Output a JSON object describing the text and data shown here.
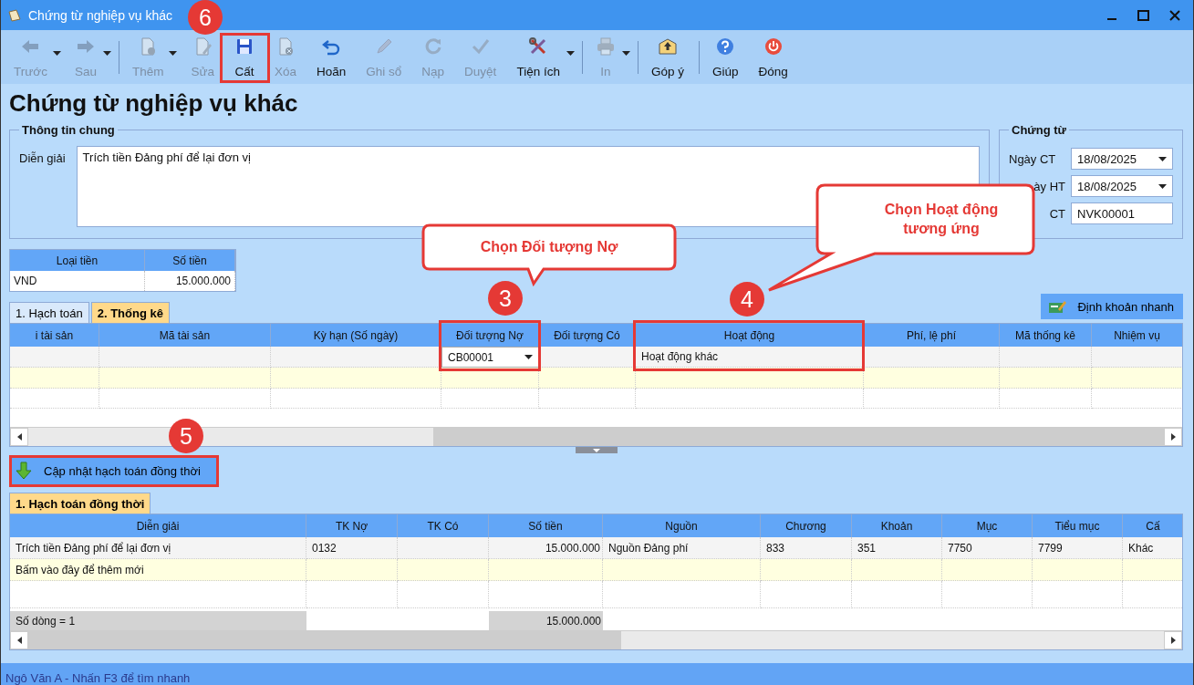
{
  "window": {
    "title": "Chứng từ nghiệp vụ khác"
  },
  "toolbar": [
    {
      "label": "Trước",
      "kind": "back",
      "disabled": true,
      "dropdown": true,
      "group_end": false
    },
    {
      "label": "Sau",
      "kind": "forward",
      "disabled": true,
      "dropdown": true,
      "group_end": true
    },
    {
      "label": "Thêm",
      "kind": "new",
      "disabled": true,
      "dropdown": true,
      "group_end": false
    },
    {
      "label": "Sửa",
      "kind": "edit",
      "disabled": true,
      "dropdown": false,
      "group_end": false
    },
    {
      "label": "Cất",
      "kind": "save",
      "disabled": false,
      "dropdown": false,
      "group_end": false
    },
    {
      "label": "Xóa",
      "kind": "delete",
      "disabled": true,
      "dropdown": false,
      "group_end": false
    },
    {
      "label": "Hoãn",
      "kind": "undo",
      "disabled": false,
      "dropdown": false,
      "group_end": false
    },
    {
      "label": "Ghi sổ",
      "kind": "post",
      "disabled": true,
      "dropdown": false,
      "group_end": false
    },
    {
      "label": "Nạp",
      "kind": "reload",
      "disabled": true,
      "dropdown": false,
      "group_end": false
    },
    {
      "label": "Duyệt",
      "kind": "approve",
      "disabled": true,
      "dropdown": false,
      "group_end": false
    },
    {
      "label": "Tiện ích",
      "kind": "tools",
      "disabled": false,
      "dropdown": true,
      "group_end": true
    },
    {
      "label": "In",
      "kind": "print",
      "disabled": true,
      "dropdown": true,
      "group_end": true
    },
    {
      "label": "Góp ý",
      "kind": "feedback",
      "disabled": false,
      "dropdown": false,
      "group_end": true
    },
    {
      "label": "Giúp",
      "kind": "help",
      "disabled": false,
      "dropdown": false,
      "group_end": false
    },
    {
      "label": "Đóng",
      "kind": "close",
      "disabled": false,
      "dropdown": false,
      "group_end": false
    }
  ],
  "heading": "Chứng từ nghiệp vụ khác",
  "general_info": {
    "legend": "Thông tin chung",
    "description_label": "Diễn giải",
    "description": "Trích tiền Đảng phí để lại đơn vị"
  },
  "voucher": {
    "legend": "Chứng từ",
    "fields": [
      {
        "label": "Ngày CT",
        "value": "18/08/2025",
        "kind": "date"
      },
      {
        "label": "ày HT",
        "value": "18/08/2025",
        "kind": "date"
      },
      {
        "label": "CT",
        "value": "NVK00001",
        "kind": "text"
      }
    ]
  },
  "currency": {
    "columns": [
      "Loại tiền",
      "Số tiền"
    ],
    "rows": [
      [
        "VND",
        "15.000.000"
      ]
    ]
  },
  "quick_entry_button": "Định khoản nhanh",
  "tabs": [
    {
      "label": "1. Hạch toán",
      "selected": false
    },
    {
      "label": "2. Thống kê",
      "selected": true
    }
  ],
  "stats_grid": {
    "columns": [
      {
        "label": "i tài sản",
        "kind": "text"
      },
      {
        "label": "Mã tài sản",
        "kind": "text"
      },
      {
        "label": "Kỳ hạn (Số ngày)",
        "kind": "text"
      },
      {
        "label": "Đối tượng Nợ",
        "kind": "dropdown"
      },
      {
        "label": "Đối tượng Có",
        "kind": "text"
      },
      {
        "label": "Hoạt động",
        "kind": "text"
      },
      {
        "label": "Phí, lệ phí",
        "kind": "text"
      },
      {
        "label": "Mã thống kê",
        "kind": "text"
      },
      {
        "label": "Nhiệm vụ",
        "kind": "text"
      }
    ],
    "rows": [
      {
        "kind": "data",
        "cells": [
          null,
          null,
          null,
          "CB00001",
          null,
          "Hoạt động khác",
          null,
          null,
          null
        ]
      },
      {
        "kind": "new",
        "cells": []
      },
      {
        "kind": "blank",
        "cells": []
      }
    ]
  },
  "update_button": "Cập nhật hạch toán đồng thời",
  "lower_tab": {
    "label": "1. Hạch toán đồng thời",
    "selected": true
  },
  "entries_grid": {
    "columns": [
      {
        "label": "Diễn giải",
        "kind": "text"
      },
      {
        "label": "TK Nợ",
        "kind": "text"
      },
      {
        "label": "TK Có",
        "kind": "text"
      },
      {
        "label": "Số tiền",
        "kind": "amount"
      },
      {
        "label": "Nguồn",
        "kind": "text"
      },
      {
        "label": "Chương",
        "kind": "text"
      },
      {
        "label": "Khoản",
        "kind": "text"
      },
      {
        "label": "Mục",
        "kind": "text"
      },
      {
        "label": "Tiểu mục",
        "kind": "text"
      },
      {
        "label": "Cấ",
        "kind": "text"
      }
    ],
    "rows": [
      {
        "kind": "data",
        "cells": [
          "Trích tiền Đảng phí để lại đơn vị",
          "0132",
          null,
          "15.000.000",
          "Nguồn Đảng phí",
          "833",
          "351",
          "7750",
          "7799",
          "Khác"
        ]
      },
      {
        "kind": "new",
        "cells": [
          "Bấm vào đây để thêm mới"
        ]
      },
      {
        "kind": "blank",
        "cells": []
      }
    ],
    "footer": {
      "label": "Số dòng = 1",
      "total": "15.000.000"
    }
  },
  "status_bar": "Ngô Văn A - Nhấn F3 để tìm nhanh",
  "annotations": {
    "markers": [
      "6",
      "3",
      "4",
      "5"
    ],
    "callouts": [
      {
        "text": "Chọn Đối tượng Nợ"
      },
      {
        "text": "Chọn Hoạt động tương ứng"
      }
    ]
  }
}
